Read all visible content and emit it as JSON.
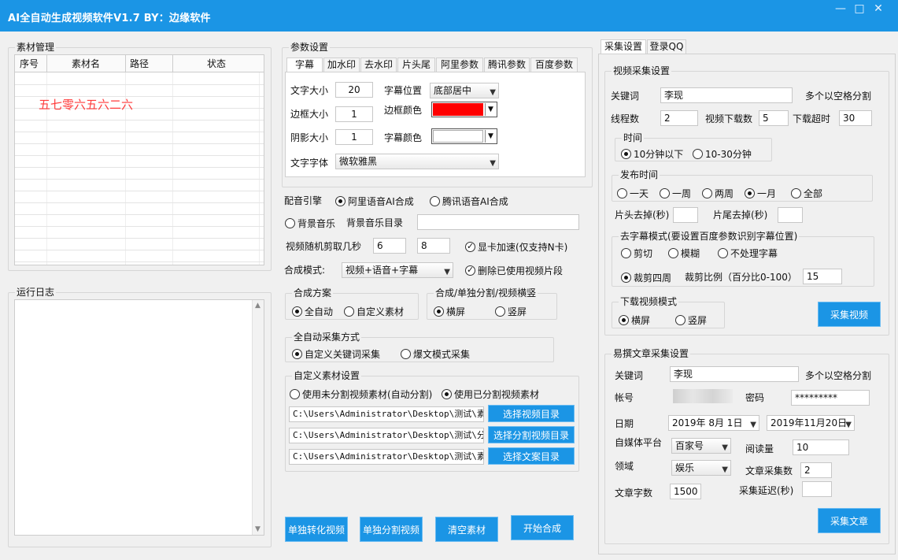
{
  "window": {
    "title": "AI全自动生成视频软件V1.7 BY：边缘软件",
    "min": "—",
    "max": "□",
    "close": "✕"
  },
  "material": {
    "legend": "素材管理",
    "columns": [
      "序号",
      "素材名",
      "路径",
      "状态"
    ],
    "watermark": "五七零六五六二六"
  },
  "log": {
    "legend": "运行日志"
  },
  "params": {
    "legend": "参数设置",
    "tabs": [
      "字幕",
      "加水印",
      "去水印",
      "片头尾",
      "阿里参数",
      "腾讯参数",
      "百度参数"
    ],
    "font_size_label": "文字大小",
    "font_size": "20",
    "border_size_label": "边框大小",
    "border_size": "1",
    "shadow_size_label": "阴影大小",
    "shadow_size": "1",
    "font_label": "文字字体",
    "font_value": "微软雅黑",
    "position_label": "字幕位置",
    "position_value": "底部居中",
    "border_color_label": "边框颜色",
    "border_color": "#ff0000",
    "text_color_label": "字幕颜色",
    "text_color": "#ffffff"
  },
  "voice": {
    "engine_label": "配音引擎",
    "ali": "阿里语音AI合成",
    "tencent": "腾讯语音AI合成",
    "bgm": "背景音乐",
    "bgm_dir_label": "背景音乐目录",
    "bgm_dir": "",
    "cut_label": "视频随机剪取几秒",
    "cut_min": "6",
    "cut_max": "8",
    "gpu": "显卡加速(仅支持N卡)",
    "mode_label": "合成模式:",
    "mode_value": "视频+语音+字幕",
    "delete_used": "删除已使用视频片段"
  },
  "plan": {
    "legend": "合成方案",
    "auto": "全自动",
    "custom": "自定义素材"
  },
  "split": {
    "legend": "合成/单独分割/视频横竖",
    "landscape": "横屏",
    "portrait": "竖屏"
  },
  "autocollect": {
    "legend": "全自动采集方式",
    "keyword": "自定义关键词采集",
    "viral": "爆文模式采集"
  },
  "custom_material": {
    "legend": "自定义素材设置",
    "unsplit": "使用未分割视频素材(自动分割)",
    "split": "使用已分割视频素材",
    "path1": "C:\\Users\\Administrator\\Desktop\\测试\\素材\\",
    "path2": "C:\\Users\\Administrator\\Desktop\\测试\\分割\\",
    "path3": "C:\\Users\\Administrator\\Desktop\\测试\\素材\\",
    "btn1": "选择视频目录",
    "btn2": "选择分割视频目录",
    "btn3": "选择文案目录"
  },
  "actions": {
    "convert": "单独转化视频",
    "split": "单独分割视频",
    "clear": "清空素材",
    "start": "开始合成"
  },
  "right_tabs": [
    "采集设置",
    "登录QQ"
  ],
  "video_collect": {
    "legend": "视频采集设置",
    "keyword_label": "关键词",
    "keyword": "李现",
    "hint": "多个以空格分割",
    "threads_label": "线程数",
    "threads": "2",
    "downloads_label": "视频下载数",
    "downloads": "5",
    "timeout_label": "下载超时",
    "timeout": "30",
    "time_legend": "时间",
    "time_opts": [
      "10分钟以下",
      "10-30分钟"
    ],
    "publish_legend": "发布时间",
    "publish_opts": [
      "一天",
      "一周",
      "两周",
      "一月",
      "全部"
    ],
    "head_cut_label": "片头去掉(秒)",
    "head_cut": "",
    "tail_cut_label": "片尾去掉(秒)",
    "tail_cut": "",
    "sub_legend": "去字幕模式(要设置百度参数识别字幕位置)",
    "sub_opts": [
      "剪切",
      "模糊",
      "不处理字幕"
    ],
    "crop4": "裁剪四周",
    "crop_ratio_label": "裁剪比例（百分比0-100）",
    "crop_ratio": "15",
    "dl_legend": "下载视频模式",
    "dl_opts": [
      "横屏",
      "竖屏"
    ],
    "collect_btn": "采集视频"
  },
  "article": {
    "legend": "易撰文章采集设置",
    "keyword_label": "关键词",
    "keyword": "李现",
    "hint": "多个以空格分割",
    "account_label": "帐号",
    "password_label": "密码",
    "password": "*********",
    "date_label": "日期",
    "date_from": "2019年 8月 1日",
    "date_to": "2019年11月20日",
    "platform_label": "自媒体平台",
    "platform": "百家号",
    "reads_label": "阅读量",
    "reads": "10",
    "field_label": "领域",
    "field": "娱乐",
    "count_label": "文章采集数",
    "count": "2",
    "words_label": "文章字数",
    "words": "1500",
    "delay_label": "采集延迟(秒)",
    "delay": "",
    "collect_btn": "采集文章"
  }
}
